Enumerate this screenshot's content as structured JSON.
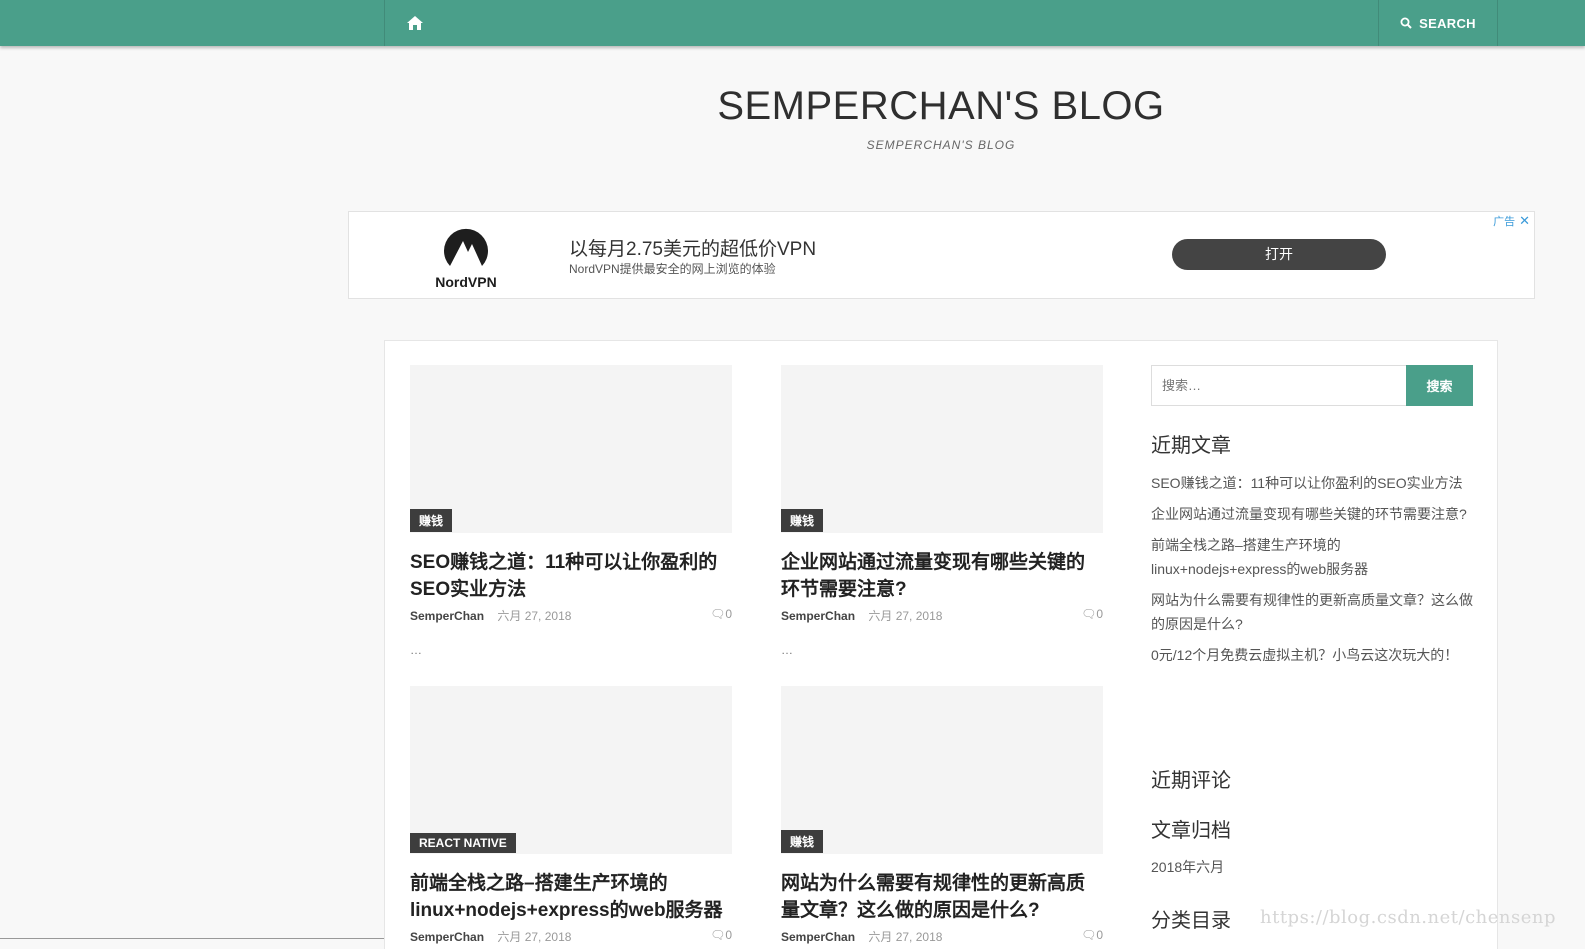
{
  "nav": {
    "search_label": "SEARCH"
  },
  "site": {
    "title": "SEMPERCHAN'S BLOG",
    "description": "SEMPERCHAN'S BLOG"
  },
  "ad": {
    "brand": "NordVPN",
    "headline": "以每月2.75美元的超低价VPN",
    "sub": "NordVPN提供最安全的网上浏览的体验",
    "button": "打开",
    "label": "广告",
    "close": "✕"
  },
  "posts": [
    {
      "category": "赚钱",
      "title": "SEO赚钱之道：11种可以让你盈利的SEO实业方法",
      "author": "SemperChan",
      "date": "六月 27, 2018",
      "comments": "0",
      "excerpt": "…"
    },
    {
      "category": "赚钱",
      "title": "企业网站通过流量变现有哪些关键的环节需要注意?",
      "author": "SemperChan",
      "date": "六月 27, 2018",
      "comments": "0",
      "excerpt": "…"
    },
    {
      "category": "REACT NATIVE",
      "title": "前端全栈之路–搭建生产环境的linux+nodejs+express的web服务器",
      "author": "SemperChan",
      "date": "六月 27, 2018",
      "comments": "0"
    },
    {
      "category": "赚钱",
      "title": "网站为什么需要有规律性的更新高质量文章？这么做的原因是什么?",
      "author": "SemperChan",
      "date": "六月 27, 2018",
      "comments": "0"
    }
  ],
  "sidebar": {
    "search_placeholder": "搜索…",
    "search_button": "搜索",
    "recent_posts_title": "近期文章",
    "recent_posts": [
      "SEO赚钱之道：11种可以让你盈利的SEO实业方法",
      "企业网站通过流量变现有哪些关键的环节需要注意?",
      "前端全栈之路–搭建生产环境的linux+nodejs+express的web服务器",
      "网站为什么需要有规律性的更新高质量文章？这么做的原因是什么?",
      "0元/12个月免费云虚拟主机？小鸟云这次玩大的！"
    ],
    "recent_comments_title": "近期评论",
    "archives_title": "文章归档",
    "archive_item": "2018年六月",
    "categories_title": "分类目录"
  },
  "watermark": "https://blog.csdn.net/chensenp",
  "colors": {
    "accent": "#4a9f8a",
    "dark": "#3d3d3d"
  }
}
